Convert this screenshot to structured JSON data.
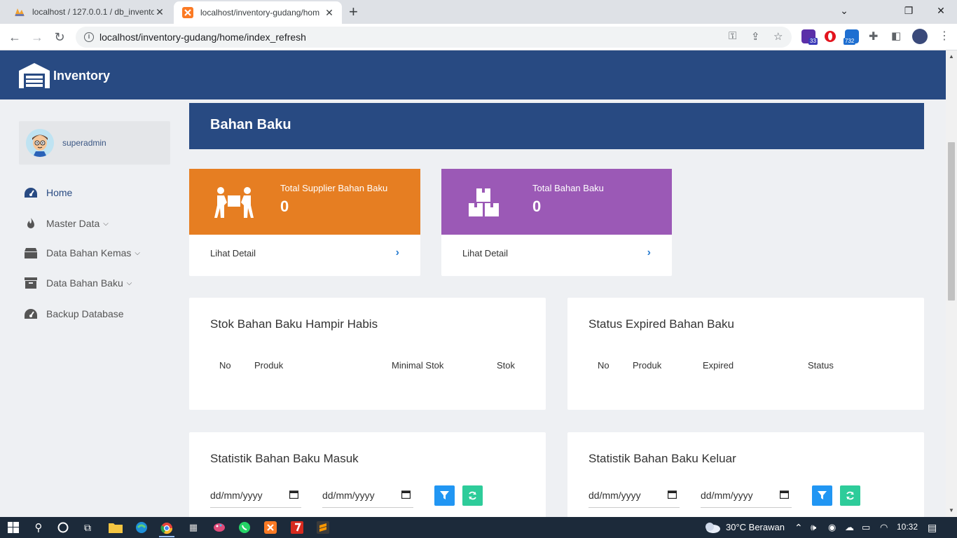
{
  "browser": {
    "tabs": [
      {
        "title": "localhost / 127.0.0.1 / db_invento"
      },
      {
        "title": "localhost/inventory-gudang/hom"
      }
    ],
    "url": "localhost/inventory-gudang/home/index_refresh",
    "ext_badges": {
      "ext1": "33",
      "ext3": "732"
    }
  },
  "app": {
    "brand": "Inventory",
    "user": "superadmin",
    "menu": [
      {
        "label": "Home",
        "active": true,
        "icon": "dashboard-icon"
      },
      {
        "label": "Master Data",
        "icon": "fire-icon",
        "has_submenu": true
      },
      {
        "label": "Data Bahan Kemas",
        "icon": "box-icon",
        "has_submenu": true
      },
      {
        "label": "Data Bahan Baku",
        "icon": "archive-icon",
        "has_submenu": true
      },
      {
        "label": "Backup Database",
        "icon": "dashboard-icon"
      }
    ],
    "banner_title": "Bahan Baku",
    "cards": [
      {
        "label": "Total Supplier Bahan Baku",
        "value": "0",
        "link": "Lihat Detail",
        "color": "#e67e22",
        "icon": "people-carry-icon"
      },
      {
        "label": "Total Bahan Baku",
        "value": "0",
        "link": "Lihat Detail",
        "color": "#9b59b6",
        "icon": "boxes-icon"
      }
    ],
    "stok_panel": {
      "title": "Stok Bahan Baku Hampir Habis",
      "columns": [
        "No",
        "Produk",
        "Minimal Stok",
        "Stok"
      ]
    },
    "expired_panel": {
      "title": "Status Expired Bahan Baku",
      "columns": [
        "No",
        "Produk",
        "Expired",
        "Status"
      ]
    },
    "masuk_panel": {
      "title": "Statistik Bahan Baku Masuk",
      "date_from": "dd/mm/yyyy",
      "date_to": "dd/mm/yyyy"
    },
    "keluar_panel": {
      "title": "Statistik Bahan Baku Keluar",
      "date_from": "dd/mm/yyyy",
      "date_to": "dd/mm/yyyy"
    },
    "colors": {
      "primary": "#284a82",
      "filter_btn": "#2196f3",
      "refresh_btn": "#2ecc9a"
    }
  },
  "taskbar": {
    "weather": "30°C  Berawan",
    "time": "10:32"
  }
}
